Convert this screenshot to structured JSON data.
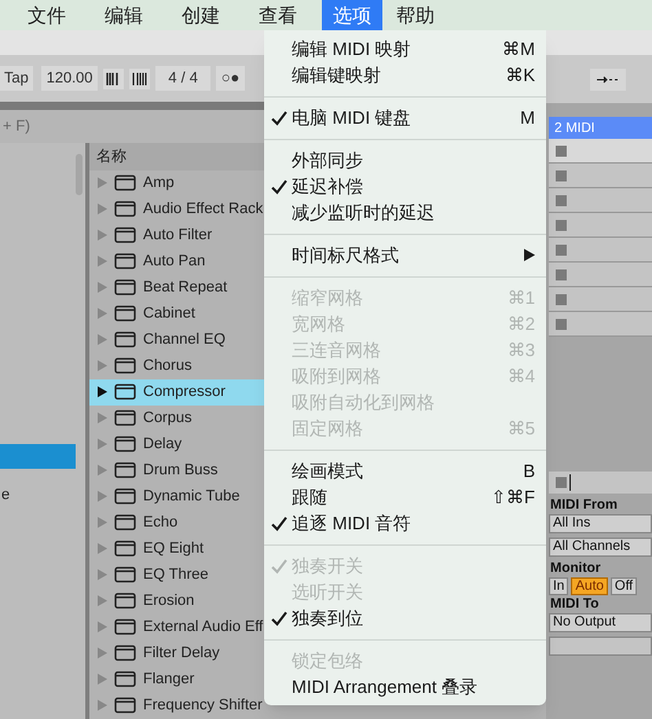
{
  "menu_bar": [
    {
      "label": "文件",
      "selected": false
    },
    {
      "label": "编辑",
      "selected": false
    },
    {
      "label": "创建",
      "selected": false
    },
    {
      "label": "查看",
      "selected": false
    },
    {
      "label": "选项",
      "selected": true
    },
    {
      "label": "帮助",
      "selected": false
    }
  ],
  "transport": {
    "tap": "Tap",
    "tempo": "120.00",
    "signature": "4 / 4",
    "metronome": "○●"
  },
  "browser_hint": "+ F)",
  "sidebar": {
    "items": [
      {
        "selected": true
      },
      {
        "label": "e",
        "selected": false
      }
    ]
  },
  "browser": {
    "column": "名称",
    "items": [
      {
        "label": "Amp",
        "selected": false
      },
      {
        "label": "Audio Effect Rack",
        "selected": false
      },
      {
        "label": "Auto Filter",
        "selected": false
      },
      {
        "label": "Auto Pan",
        "selected": false
      },
      {
        "label": "Beat Repeat",
        "selected": false
      },
      {
        "label": "Cabinet",
        "selected": false
      },
      {
        "label": "Channel EQ",
        "selected": false
      },
      {
        "label": "Chorus",
        "selected": false
      },
      {
        "label": "Compressor",
        "selected": true
      },
      {
        "label": "Corpus",
        "selected": false
      },
      {
        "label": "Delay",
        "selected": false
      },
      {
        "label": "Drum Buss",
        "selected": false
      },
      {
        "label": "Dynamic Tube",
        "selected": false
      },
      {
        "label": "Echo",
        "selected": false
      },
      {
        "label": "EQ Eight",
        "selected": false
      },
      {
        "label": "EQ Three",
        "selected": false
      },
      {
        "label": "Erosion",
        "selected": false
      },
      {
        "label": "External Audio Eff",
        "selected": false
      },
      {
        "label": "Filter Delay",
        "selected": false
      },
      {
        "label": "Flanger",
        "selected": false
      },
      {
        "label": "Frequency Shifter",
        "selected": false
      }
    ]
  },
  "options_menu": [
    {
      "kind": "item",
      "label": "编辑 MIDI 映射",
      "shortcut": "⌘M",
      "checked": false,
      "disabled": false
    },
    {
      "kind": "item",
      "label": "编辑键映射",
      "shortcut": "⌘K",
      "checked": false,
      "disabled": false
    },
    {
      "kind": "separator"
    },
    {
      "kind": "item",
      "label": "电脑 MIDI 键盘",
      "shortcut": "M",
      "checked": true,
      "disabled": false
    },
    {
      "kind": "separator"
    },
    {
      "kind": "item",
      "label": "外部同步",
      "checked": false,
      "disabled": false
    },
    {
      "kind": "item",
      "label": "延迟补偿",
      "checked": true,
      "disabled": false
    },
    {
      "kind": "item",
      "label": "减少监听时的延迟",
      "checked": false,
      "disabled": false
    },
    {
      "kind": "separator"
    },
    {
      "kind": "submenu",
      "label": "时间标尺格式",
      "checked": false,
      "disabled": false
    },
    {
      "kind": "separator"
    },
    {
      "kind": "item",
      "label": "缩窄网格",
      "shortcut": "⌘1",
      "checked": false,
      "disabled": true
    },
    {
      "kind": "item",
      "label": "宽网格",
      "shortcut": "⌘2",
      "checked": false,
      "disabled": true
    },
    {
      "kind": "item",
      "label": "三连音网格",
      "shortcut": "⌘3",
      "checked": false,
      "disabled": true
    },
    {
      "kind": "item",
      "label": "吸附到网格",
      "shortcut": "⌘4",
      "checked": false,
      "disabled": true
    },
    {
      "kind": "item",
      "label": "吸附自动化到网格",
      "checked": false,
      "disabled": true
    },
    {
      "kind": "item",
      "label": "固定网格",
      "shortcut": "⌘5",
      "checked": false,
      "disabled": true
    },
    {
      "kind": "separator"
    },
    {
      "kind": "item",
      "label": "绘画模式",
      "shortcut": "B",
      "checked": false,
      "disabled": false
    },
    {
      "kind": "item",
      "label": "跟随",
      "shortcut": "⇧⌘F",
      "checked": false,
      "disabled": false
    },
    {
      "kind": "item",
      "label": "追逐 MIDI 音符",
      "checked": true,
      "disabled": false
    },
    {
      "kind": "separator"
    },
    {
      "kind": "item",
      "label": "独奏开关",
      "checked": true,
      "disabled": true
    },
    {
      "kind": "item",
      "label": "选听开关",
      "checked": false,
      "disabled": true
    },
    {
      "kind": "item",
      "label": "独奏到位",
      "checked": true,
      "disabled": false
    },
    {
      "kind": "separator"
    },
    {
      "kind": "item",
      "label": "锁定包络",
      "checked": false,
      "disabled": true
    },
    {
      "kind": "item",
      "label": "MIDI Arrangement 叠录",
      "checked": false,
      "disabled": false
    }
  ],
  "track": {
    "name": "2 MIDI",
    "midi_from_label": "MIDI From",
    "midi_from": "All Ins",
    "channel": "All Channels",
    "monitor_label": "Monitor",
    "monitor": [
      {
        "label": "In",
        "selected": false
      },
      {
        "label": "Auto",
        "selected": true
      },
      {
        "label": "Off",
        "selected": false
      }
    ],
    "midi_to_label": "MIDI To",
    "midi_to": "No Output"
  }
}
